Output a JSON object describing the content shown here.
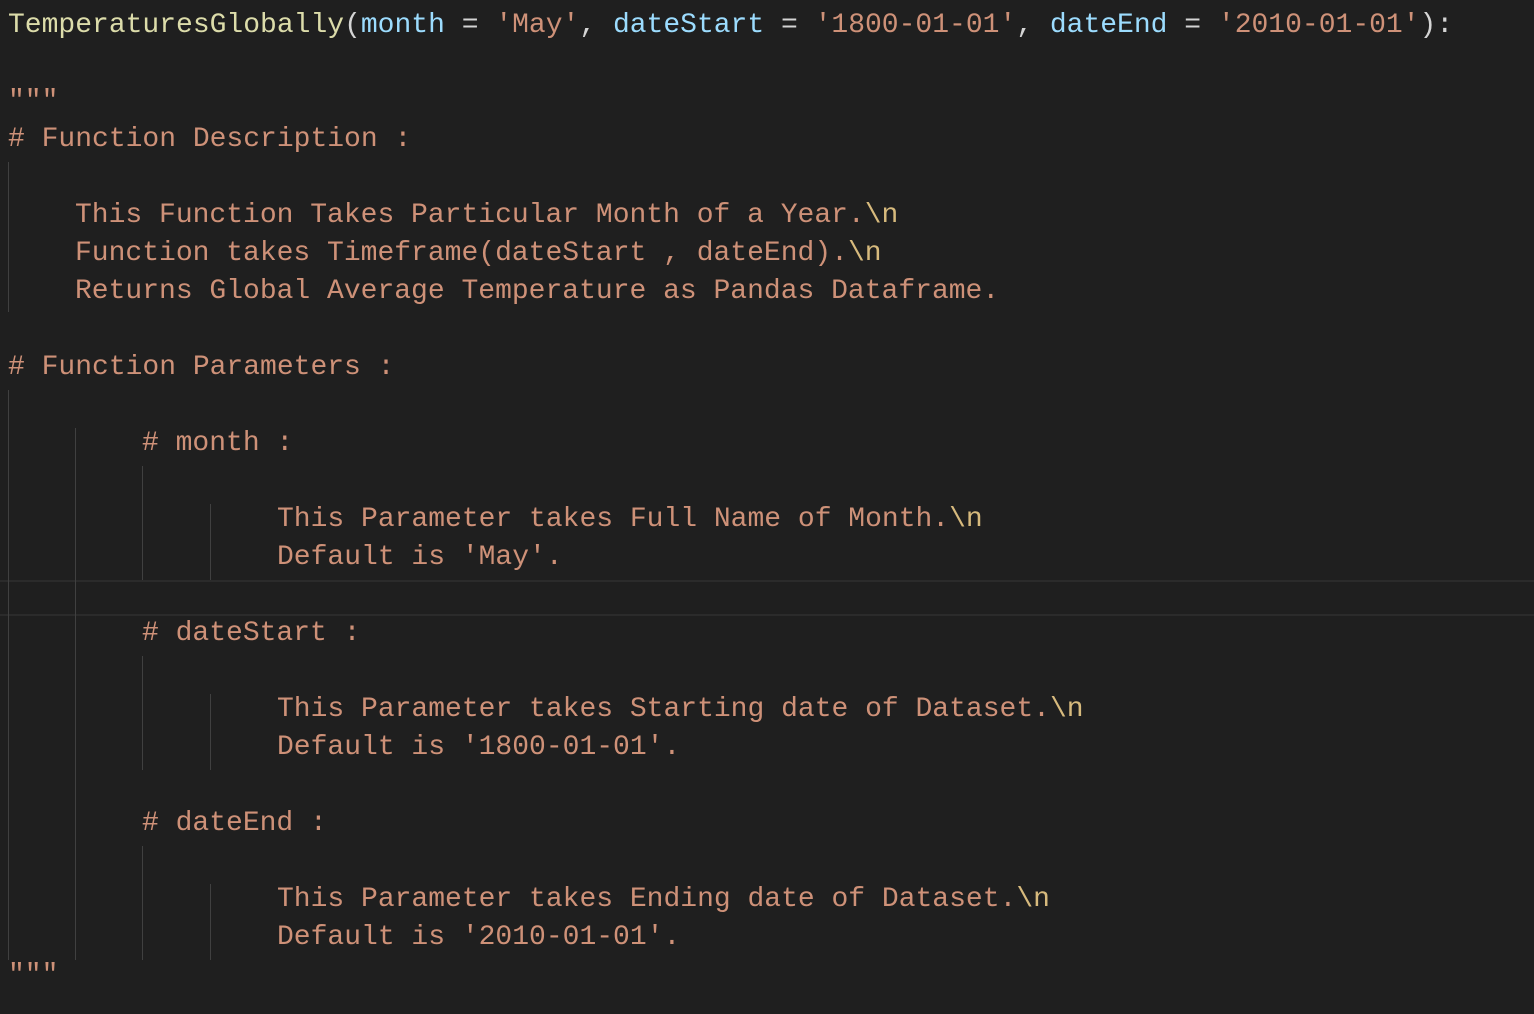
{
  "signature": {
    "name": "TemperaturesGlobally",
    "open_paren": "(",
    "p1": "month",
    "eq1": " = ",
    "v1": "'May'",
    "c1": ", ",
    "p2": "dateStart",
    "eq2": " = ",
    "v2": "'1800-01-01'",
    "c2": ", ",
    "p3": "dateEnd",
    "eq3": " = ",
    "v3": "'2010-01-01'",
    "close": "):"
  },
  "docstring": {
    "open": "\"\"\"",
    "close": "\"\"\"",
    "desc_heading": "# Function Description :",
    "desc_line1": "This Function Takes Particular Month of a Year.",
    "desc_line2": "Function takes Timeframe(dateStart , dateEnd).",
    "desc_line3": "Returns Global Average Temperature as Pandas Dataframe.",
    "params_heading": "# Function Parameters :",
    "month_heading": "# month :",
    "month_line1": "This Parameter takes Full Name of Month.",
    "month_line2": "Default is 'May'.",
    "datestart_heading": "# dateStart :",
    "datestart_line1": "This Parameter takes Starting date of Dataset.",
    "datestart_line2": "Default is '1800-01-01'.",
    "dateend_heading": "# dateEnd :",
    "dateend_line1": "This Parameter takes Ending date of Dataset.",
    "dateend_line2": "Default is '2010-01-01'.",
    "escape": "\\n"
  }
}
